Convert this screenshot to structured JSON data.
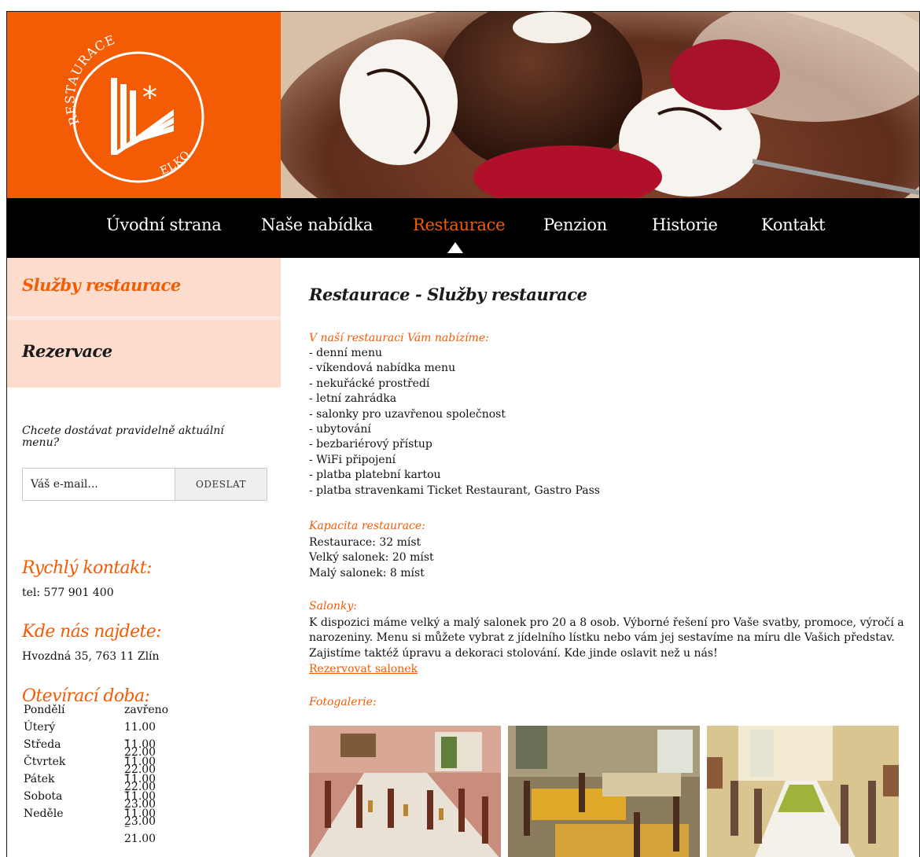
{
  "brand": {
    "logo_top_text": "RESTAURACE",
    "logo_bottom_text": "ELKO",
    "accent_color": "#f35b05",
    "tab_bg_color": "#fcdccc"
  },
  "nav": {
    "items": [
      {
        "label": "Úvodní strana",
        "active": false
      },
      {
        "label": "Naše nabídka",
        "active": false
      },
      {
        "label": "Restaurace",
        "active": true
      },
      {
        "label": "Penzion",
        "active": false
      },
      {
        "label": "Historie",
        "active": false
      },
      {
        "label": "Kontakt",
        "active": false
      }
    ]
  },
  "sidebar": {
    "tabs": [
      {
        "label": "Služby restaurace",
        "active": true
      },
      {
        "label": "Rezervace",
        "active": false
      }
    ],
    "newsletter": {
      "question": "Chcete dostávat pravidelně aktuální menu?",
      "placeholder": "Váš e-mail...",
      "button": "ODESLAT"
    },
    "contact": {
      "heading": "Rychlý kontakt:",
      "phone": "tel: 577 901 400"
    },
    "location": {
      "heading": "Kde nás najdete:",
      "address": "Hvozdná 35, 763 11 Zlín"
    },
    "hours": {
      "heading": "Otevírací doba:",
      "rows": [
        {
          "day": "Pondělí",
          "time": "zavřeno"
        },
        {
          "day": "Úterý",
          "time": "11.00 – 22.00"
        },
        {
          "day": "Středa",
          "time": "11.00 – 22.00"
        },
        {
          "day": "Čtvrtek",
          "time": "11.00 – 22.00"
        },
        {
          "day": "Pátek",
          "time": "11.00 – 23.00"
        },
        {
          "day": "Sobota",
          "time": "11.00 – 23.00"
        },
        {
          "day": "Neděle",
          "time": "11.00 – 21.00"
        }
      ]
    }
  },
  "main": {
    "title": "Restaurace - Služby restaurace",
    "offer_heading": "V naší restauraci Vám nabízíme:",
    "offer_items": [
      "- denní menu",
      "- víkendová nabídka menu",
      "- nekuřácké prostředí",
      "- letní zahrádka",
      "- salonky pro uzavřenou společnost",
      "- ubytování",
      "- bezbariérový přístup",
      "- WiFi připojení",
      "- platba platební kartou",
      "- platba stravenkami Ticket Restaurant, Gastro Pass"
    ],
    "capacity_heading": "Kapacita restaurace:",
    "capacity_items": [
      "Restaurace: 32 míst",
      "Velký salonek: 20 míst",
      "Malý salonek: 8 míst"
    ],
    "salonky_heading": "Salonky:",
    "salonky_text": "K dispozici máme velký a malý salonek pro 20 a 8 osob. Výborné řešení pro Vaše svatby, promoce, výročí a narozeniny. Menu si můžete vybrat z jídelního lístku nebo vám jej sestavíme na míru dle Vašich představ. Zajistíme taktéž úpravu a dekoraci stolování. Kde jinde oslavit než u nás!",
    "salonky_link": "Rezervovat salonek",
    "gallery_heading": "Fotogalerie:"
  }
}
